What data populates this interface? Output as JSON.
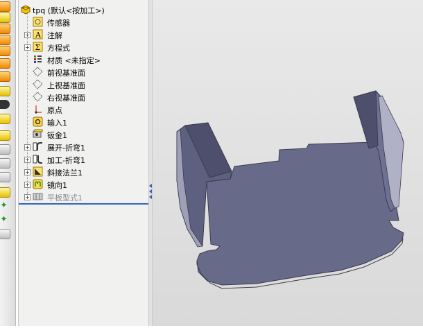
{
  "tree": {
    "root": {
      "name": "tpq",
      "config": "(默认<按加工>)",
      "icon": "part-icon"
    },
    "items": [
      {
        "label": "传感器",
        "icon": "sensor-icon",
        "expandable": false
      },
      {
        "label": "注解",
        "icon": "annotation-icon",
        "expandable": true
      },
      {
        "label": "方程式",
        "icon": "equation-icon",
        "expandable": true
      },
      {
        "label": "材质 <未指定>",
        "icon": "material-icon",
        "expandable": false
      },
      {
        "label": "前视基准面",
        "icon": "plane-icon",
        "expandable": false
      },
      {
        "label": "上视基准面",
        "icon": "plane-icon",
        "expandable": false
      },
      {
        "label": "右视基准面",
        "icon": "plane-icon",
        "expandable": false
      },
      {
        "label": "原点",
        "icon": "origin-icon",
        "expandable": false
      },
      {
        "label": "输入1",
        "icon": "imported-body-icon",
        "expandable": false
      },
      {
        "label": "钣金1",
        "icon": "sheet-metal-icon",
        "expandable": false
      },
      {
        "label": "展开-折弯1",
        "icon": "unfold-bend-icon",
        "expandable": true
      },
      {
        "label": "加工-折弯1",
        "icon": "process-bend-icon",
        "expandable": true
      },
      {
        "label": "斜接法兰1",
        "icon": "miter-flange-icon",
        "expandable": true
      },
      {
        "label": "镜向1",
        "icon": "mirror-icon",
        "expandable": true
      },
      {
        "label": "平板型式1",
        "icon": "flat-pattern-icon",
        "expandable": true,
        "suppressed": true
      }
    ]
  },
  "toolbar": {
    "buttons": [
      "orange",
      "yellow",
      "orange",
      "orange",
      "orange",
      "orange",
      "orange",
      "yellow",
      "dark",
      "yellow",
      "yellow",
      "grey",
      "grey",
      "grey",
      "yellow",
      "green",
      "green",
      "grey"
    ]
  },
  "colors": {
    "part_face": "#6b6d8c",
    "part_edge": "#3b3c4d",
    "viewport_bg": "#dedede",
    "rollback_bar": "#2b66c9"
  }
}
